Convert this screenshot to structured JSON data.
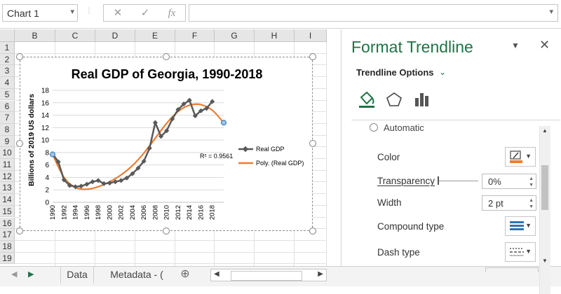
{
  "formula_bar": {
    "name_box": "Chart 1",
    "fx": "fx",
    "cancel": "✕",
    "enter": "✓"
  },
  "grid": {
    "columns": [
      "B",
      "C",
      "D",
      "E",
      "F",
      "G",
      "H",
      "I"
    ],
    "rows": [
      "1",
      "2",
      "3",
      "4",
      "5",
      "6",
      "7",
      "8",
      "9",
      "10",
      "11",
      "12",
      "13",
      "14",
      "15",
      "16",
      "17",
      "18",
      "19"
    ]
  },
  "sheet_tabs": {
    "tabs": [
      "Data",
      "Metadata - (",
      "..."
    ],
    "add": "⊕"
  },
  "panel": {
    "title": "Format Trendline",
    "options_label": "Trendline Options",
    "automatic_label": "Automatic",
    "color_label": "Color",
    "transparency_label": "Transparency",
    "transparency_value": "0%",
    "width_label": "Width",
    "width_value": "2 pt",
    "compound_label": "Compound type",
    "dash_label": "Dash type",
    "accent": "#217346",
    "trend_color": "#ed7d31"
  },
  "chart_data": {
    "type": "line",
    "title": "Real GDP of Georgia, 1990-2018",
    "ylabel": "Billions of 2019 US dollars",
    "xlabel": "",
    "ylim": [
      0,
      18
    ],
    "yticks": [
      0,
      2,
      4,
      6,
      8,
      10,
      12,
      14,
      16,
      18
    ],
    "xticks": [
      "1990",
      "1992",
      "1994",
      "1996",
      "1998",
      "2000",
      "2002",
      "2004",
      "2006",
      "2008",
      "2010",
      "2012",
      "2014",
      "2016",
      "2018"
    ],
    "annotation": "R² = 0.9561",
    "series": [
      {
        "name": "Real GDP",
        "color": "#595959",
        "x": [
          1990,
          1991,
          1992,
          1993,
          1994,
          1995,
          1996,
          1997,
          1998,
          1999,
          2000,
          2001,
          2002,
          2003,
          2004,
          2005,
          2006,
          2007,
          2008,
          2009,
          2010,
          2011,
          2012,
          2013,
          2014,
          2015,
          2016,
          2017,
          2018
        ],
        "y": [
          7.8,
          6.5,
          3.6,
          2.7,
          2.5,
          2.6,
          2.9,
          3.3,
          3.5,
          3.0,
          3.1,
          3.3,
          3.5,
          3.9,
          4.6,
          5.5,
          6.6,
          8.7,
          12.8,
          10.6,
          11.5,
          13.4,
          14.9,
          15.8,
          16.4,
          13.9,
          14.7,
          15.1,
          16.2
        ]
      },
      {
        "name": "Poly. (Real GDP)",
        "color": "#ed7d31",
        "x": [
          1990,
          1992,
          1994,
          1996,
          1998,
          2000,
          2002,
          2004,
          2006,
          2008,
          2010,
          2012,
          2014,
          2016,
          2018,
          2020
        ],
        "y": [
          7.7,
          4.0,
          2.4,
          2.1,
          2.5,
          3.3,
          4.4,
          5.9,
          7.9,
          10.3,
          12.7,
          14.6,
          15.6,
          15.7,
          14.8,
          12.8
        ]
      }
    ]
  }
}
